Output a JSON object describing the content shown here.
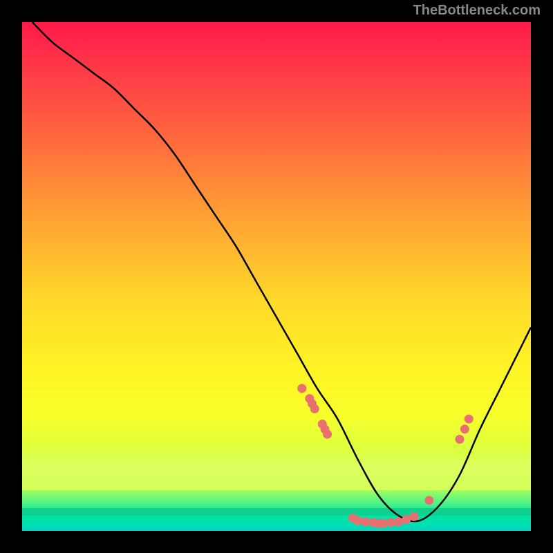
{
  "watermark": "TheBottleneck.com",
  "chart_data": {
    "type": "line",
    "title": "",
    "xlabel": "",
    "ylabel": "",
    "xlim": [
      0,
      100
    ],
    "ylim": [
      0,
      100
    ],
    "series": [
      {
        "name": "curve",
        "x": [
          2,
          6,
          10,
          14,
          18,
          22,
          26,
          30,
          34,
          38,
          42,
          46,
          50,
          54,
          58,
          62,
          66,
          70,
          74,
          78,
          82,
          86,
          90,
          94,
          98,
          100
        ],
        "y": [
          100,
          96,
          93,
          90,
          87,
          83,
          79,
          74,
          68,
          62,
          56,
          49,
          42,
          35,
          28,
          22,
          14,
          7,
          3,
          2,
          5,
          11,
          20,
          28,
          36,
          40
        ]
      }
    ],
    "markers": [
      {
        "x": 55,
        "y": 28
      },
      {
        "x": 56.5,
        "y": 26
      },
      {
        "x": 57,
        "y": 25
      },
      {
        "x": 57.5,
        "y": 24
      },
      {
        "x": 59,
        "y": 21
      },
      {
        "x": 59.5,
        "y": 20
      },
      {
        "x": 60,
        "y": 19
      },
      {
        "x": 65,
        "y": 2.5
      },
      {
        "x": 66,
        "y": 2
      },
      {
        "x": 67.5,
        "y": 1.8
      },
      {
        "x": 69,
        "y": 1.6
      },
      {
        "x": 70,
        "y": 1.5
      },
      {
        "x": 71,
        "y": 1.5
      },
      {
        "x": 72.5,
        "y": 1.6
      },
      {
        "x": 74,
        "y": 1.8
      },
      {
        "x": 75.5,
        "y": 2.2
      },
      {
        "x": 77,
        "y": 2.8
      },
      {
        "x": 80,
        "y": 6
      },
      {
        "x": 86,
        "y": 18
      },
      {
        "x": 87,
        "y": 20
      },
      {
        "x": 87.8,
        "y": 22
      }
    ],
    "annotations": []
  }
}
